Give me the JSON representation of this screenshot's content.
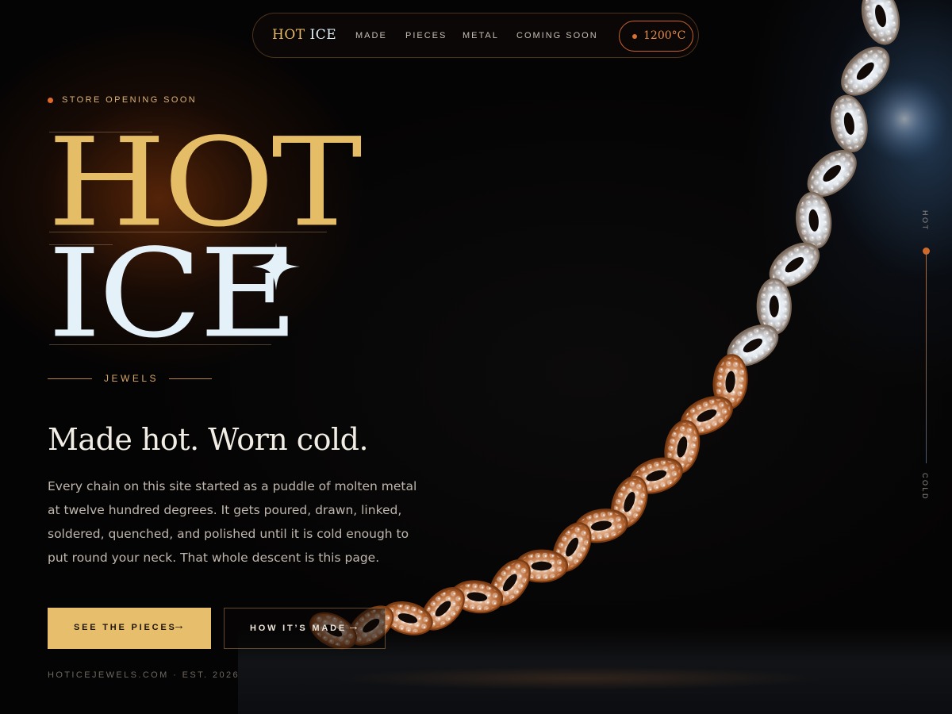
{
  "nav": {
    "brand_hot": "HOT",
    "brand_ice": "ICE",
    "links": [
      "MADE",
      "PIECES",
      "METAL",
      "COMING SOON"
    ],
    "temperature": "1200°C"
  },
  "hero": {
    "eyebrow": "STORE OPENING SOON",
    "title_line1": "HOT",
    "title_line2": "ICE",
    "subtitle": "JEWELS",
    "tagline": "Made hot. Worn cold.",
    "description": "Every chain on this site started as a puddle of molten metal at twelve hundred degrees. It gets poured, drawn, linked, soldered, quenched, and polished until it is cold enough to put round your neck. That whole descent is this page.",
    "primary_cta": "SEE THE PIECES",
    "secondary_cta": "HOW IT’S MADE",
    "arrow": "→"
  },
  "footer": {
    "text": "HOTICEJEWELS.COM · EST. 2026"
  },
  "scale": {
    "top_label": "HOT",
    "bottom_label": "COLD"
  },
  "colors": {
    "gold": "#e6bd67",
    "ice": "#e4f1f9",
    "ember": "#d8702f",
    "background": "#050404"
  },
  "icons": {
    "eyebrow_dot": "ember-dot-icon",
    "sparkle": "four-point-star-icon",
    "arrow": "arrow-right-icon",
    "hero_image": "iced-out-cuban-link-chain"
  }
}
